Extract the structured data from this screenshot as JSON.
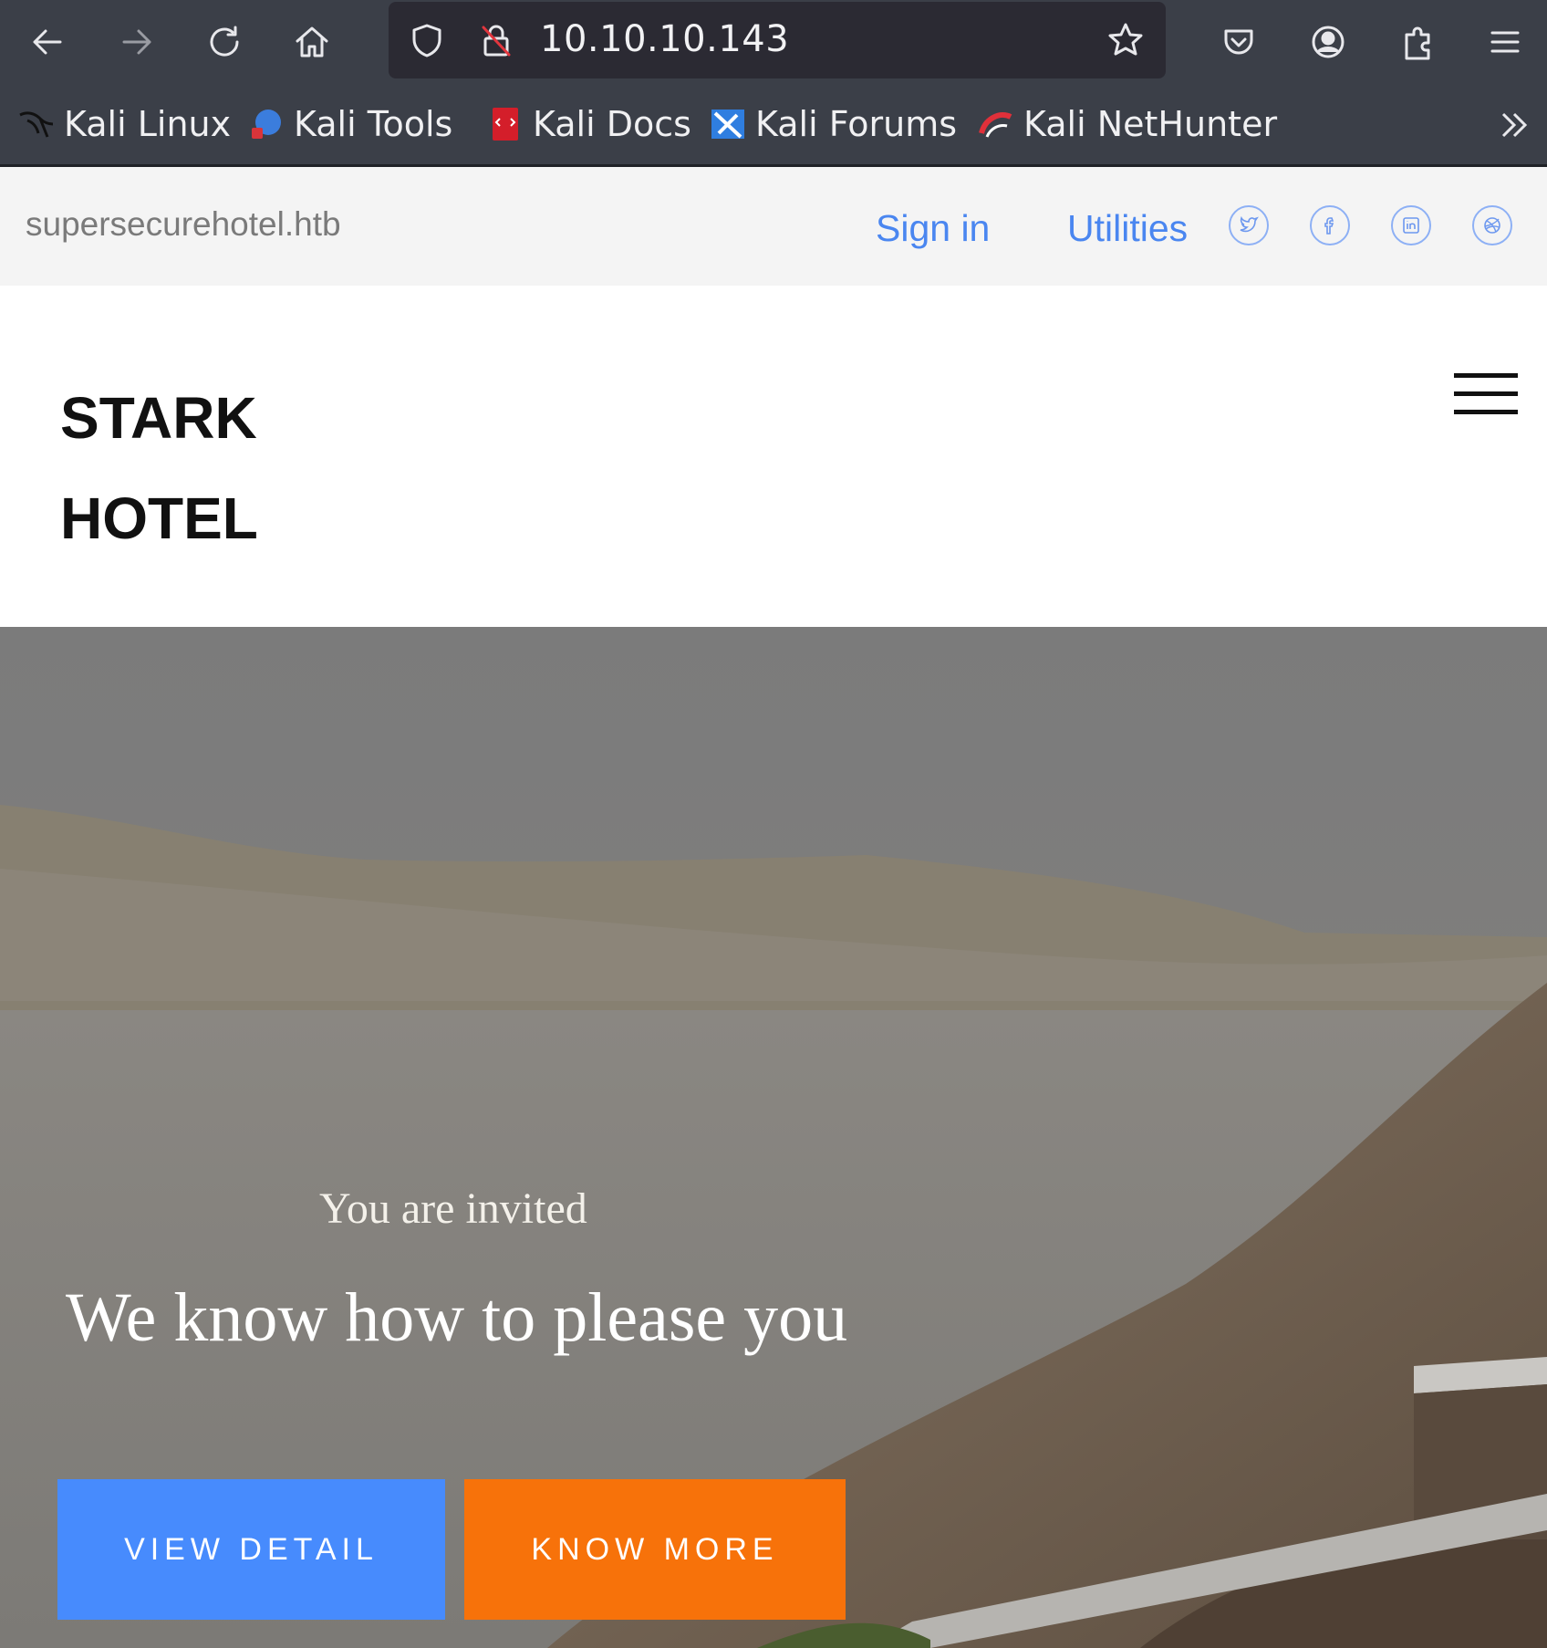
{
  "browser": {
    "url": "10.10.10.143",
    "bookmarks": [
      {
        "label": "Kali Linux",
        "icon": "kali-dragon-icon"
      },
      {
        "label": "Kali Tools",
        "icon": "kali-tools-icon"
      },
      {
        "label": "Kali Docs",
        "icon": "kali-docs-icon"
      },
      {
        "label": "Kali Forums",
        "icon": "kali-forums-icon"
      },
      {
        "label": "Kali NetHunter",
        "icon": "kali-nethunter-icon"
      }
    ]
  },
  "topbar": {
    "domain": "supersecurehotel.htb",
    "links": [
      "Sign in",
      "Utilities"
    ],
    "social": [
      "twitter-icon",
      "facebook-icon",
      "linkedin-icon",
      "dribbble-icon"
    ]
  },
  "header": {
    "brand_line1": "STARK",
    "brand_line2": "HOTEL"
  },
  "hero": {
    "subtitle": "You are invited",
    "title": "We know how to please you",
    "buttons": [
      "VIEW DETAIL",
      "KNOW MORE"
    ]
  },
  "colors": {
    "accent_blue": "#478bfd",
    "accent_orange": "#f7720a",
    "link_blue": "#4a86f0",
    "chrome": "#3b3f48"
  }
}
